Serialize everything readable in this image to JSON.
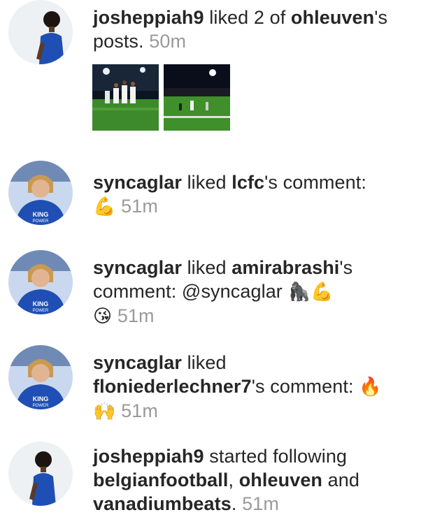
{
  "notifications": [
    {
      "user": "josheppiah9",
      "action": " liked 2 of ",
      "target": "ohleuven",
      "suffix": "'s posts.",
      "time": "50m",
      "avatar_icon": "avatar-player-blue-kit"
    },
    {
      "user": "syncaglar",
      "action": " liked ",
      "target": "lcfc",
      "suffix": "'s comment:",
      "emoji": "💪",
      "time": "51m",
      "avatar_icon": "avatar-player-king-power-kit"
    },
    {
      "user": "syncaglar",
      "action": " liked ",
      "target": "amirabrashi",
      "suffix": "'s",
      "comment_prefix": "comment: @syncaglar ",
      "emoji1": "🦍",
      "emoji2": "💪",
      "emoji3": "😘",
      "time": "51m",
      "avatar_icon": "avatar-player-king-power-kit"
    },
    {
      "user": "syncaglar",
      "action": " liked",
      "target": "floniederlechner7",
      "suffix": "'s comment: ",
      "emoji1": "🔥",
      "emoji2": "🙌",
      "time": "51m",
      "avatar_icon": "avatar-player-king-power-kit"
    },
    {
      "user": "josheppiah9",
      "action": " started following",
      "target1": "belgianfootball",
      "sep": ", ",
      "target2": "ohleuven",
      "and": " and",
      "target3": "vanadiumbeats",
      "suffix": ".",
      "time": "51m",
      "avatar_icon": "avatar-player-blue-kit"
    }
  ],
  "icons": {
    "thumb1": "post-thumbnail-team-celebration",
    "thumb2": "post-thumbnail-stadium-night"
  }
}
